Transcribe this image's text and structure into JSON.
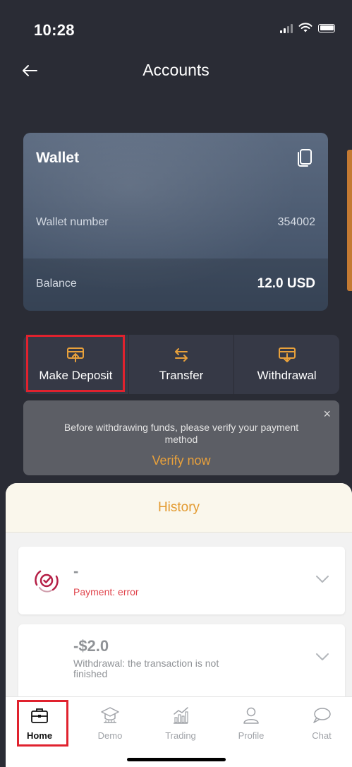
{
  "status_bar": {
    "time": "10:28"
  },
  "nav": {
    "title": "Accounts"
  },
  "wallet": {
    "title": "Wallet",
    "number_label": "Wallet number",
    "number_value": "354002",
    "balance_label": "Balance",
    "balance_value": "12.0 USD"
  },
  "actions": [
    {
      "label": "Make Deposit",
      "icon": "deposit-icon"
    },
    {
      "label": "Transfer",
      "icon": "transfer-arrows-icon"
    },
    {
      "label": "Withdrawal",
      "icon": "withdrawal-icon"
    }
  ],
  "verify_banner": {
    "text": "Before withdrawing funds, please verify your payment method",
    "link": "Verify now",
    "close": "×"
  },
  "history": {
    "title": "History",
    "transactions": [
      {
        "amount": "-",
        "status": "Payment: error",
        "icon": "payment-processor-icon"
      },
      {
        "amount": "-$2.0",
        "status": "Withdrawal: the transaction is not finished"
      }
    ]
  },
  "tab_bar": {
    "tabs": [
      {
        "label": "Home",
        "icon": "briefcase-icon",
        "active": true
      },
      {
        "label": "Demo",
        "icon": "graduation-cap-icon"
      },
      {
        "label": "Trading",
        "icon": "chart-icon"
      },
      {
        "label": "Profile",
        "icon": "person-icon"
      },
      {
        "label": "Chat",
        "icon": "chat-bubble-icon"
      }
    ]
  },
  "colors": {
    "background": "#2a2c35",
    "accent_orange": "#e39a30",
    "error_red": "#e0444c",
    "highlight_red": "#e0222e"
  }
}
